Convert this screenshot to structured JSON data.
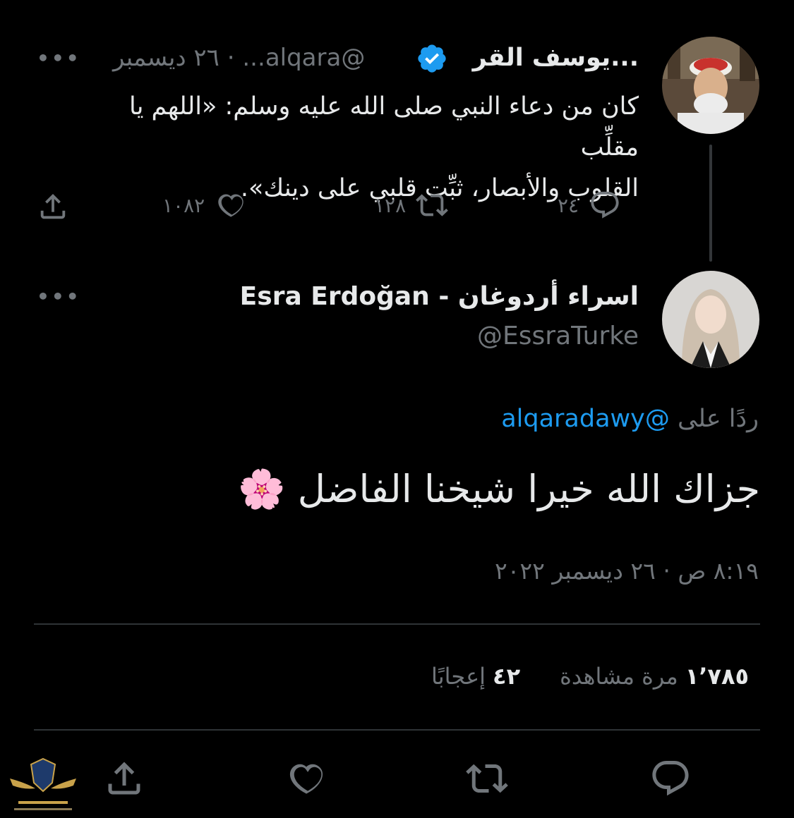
{
  "parent_tweet": {
    "name": "يوسف القر...",
    "handle_date": "@alqara... · ٢٦ ديسمبر",
    "text_line1": "كان من دعاء النبي صلى الله عليه وسلم: «اللهم يا مقلِّب",
    "text_line2": "القلوب والأبصار، ثبِّت قلبي على دينك».",
    "more": "•••",
    "replies": "٢٤",
    "retweets": "١٢٨",
    "likes": "١٠٨٢"
  },
  "reply_tweet": {
    "name": "اسراء أردوغان - Esra Erdoğan",
    "handle": "@EssraTurke",
    "more": "•••",
    "replying_prefix": "ردًا على",
    "replying_to": "@alqaradawy",
    "text": "جزاك الله خيرا شيخنا الفاضل 🌸",
    "timestamp": "٨:١٩ ص · ٢٦ ديسمبر ٢٠٢٢"
  },
  "stats": {
    "views_count": "١٬٧٨٥",
    "views_label": "مرة مشاهدة",
    "likes_count": "٤٢",
    "likes_label": "إعجابًا"
  },
  "colors": {
    "background": "#000000",
    "text": "#e7e9ea",
    "muted": "#71767b",
    "link": "#1d9bf0",
    "divider": "#2f3336"
  },
  "icons": [
    "verified-badge-icon",
    "more-icon",
    "reply-icon",
    "retweet-icon",
    "like-icon",
    "share-icon"
  ]
}
